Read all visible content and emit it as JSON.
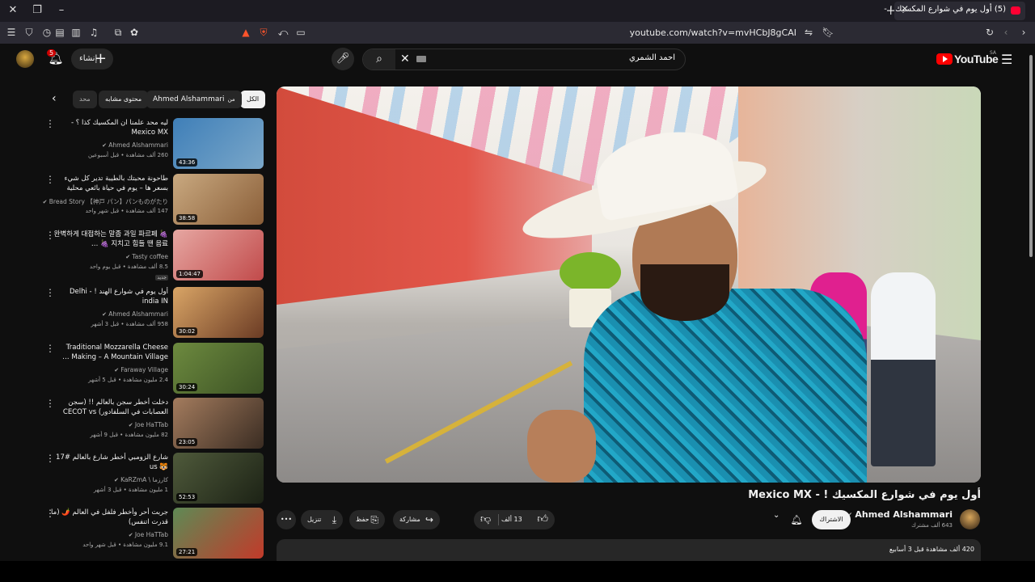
{
  "browser": {
    "tab_title": "(5) أول يوم في شوارع المكسيك ! -",
    "url": "youtube.com/watch?v=mvHCbJ8gCAI"
  },
  "masthead": {
    "logo": "YouTube",
    "region": "SA",
    "search_query": "احمد الشمري",
    "create_label": "إنشاء",
    "notif_count": "5"
  },
  "video": {
    "title": "أول يوم في شوارع المكسيك ! - Mexico MX",
    "channel": "Ahmed Alshammari",
    "subscribers": "643 ألف مشترك",
    "subscribe_label": "الاشتراك",
    "likes": "13 ألف",
    "share_label": "مشاركة",
    "save_label": "حفظ",
    "download_label": "تنزيل",
    "stats": "420 ألف مشاهدة قبل 3 أسابيع"
  },
  "chips": {
    "all": "الكل",
    "from": "من",
    "from_name": "Ahmed Alshammari",
    "related": "محتوى مشابه",
    "more": "محد"
  },
  "recs": [
    {
      "title": "ليه محد علمنا ان المكسيك كذا ؟ - Mexico MX",
      "channel": "Ahmed Alshammari",
      "meta": "260 ألف مشاهدة • قبل أسبوعين",
      "duration": "43:36",
      "colors": [
        "#3f7fb8",
        "#7aa7c9"
      ]
    },
    {
      "title": "طاحونة محبتك بالطيبة تدير كل شيء بسعر ها – يوم في حياة بائعي محلية",
      "channel": "Bread Story 【神戸 パン】パンものがたり",
      "meta": "147 ألف مشاهدة • قبل شهر واحد",
      "duration": "38:58",
      "colors": [
        "#c9a980",
        "#8a5e38"
      ]
    },
    {
      "title": "🍇 완벽하게 대접하는 말좀 과일 파르페 🍇 지치고 힘들 땐 음료 …",
      "channel": "Tasty coffee",
      "meta": "8.5 ألف مشاهدة • قبل يوم واحد",
      "duration": "1:04:47",
      "badge": "جديد",
      "colors": [
        "#e6a7a2",
        "#c14a4a"
      ]
    },
    {
      "title": "أول يوم في شوارع الهند ! - Delhi india IN",
      "channel": "Ahmed Alshammari",
      "meta": "958 ألف مشاهدة • قبل 3 أشهر",
      "duration": "30:02",
      "colors": [
        "#d9a566",
        "#6b3b24"
      ]
    },
    {
      "title": "Traditional Mozzarella Cheese Making – A Mountain Village …",
      "channel": "Faraway Village",
      "meta": "2.4 مليون مشاهدة • قبل 5 أشهر",
      "duration": "30:24",
      "colors": [
        "#6d8a3f",
        "#3c5224"
      ]
    },
    {
      "title": "دخلت أخطر سجن بالعالم !! (سجن العصابات في السلفادور) CECOT vs",
      "channel": "Joe HaTTab",
      "meta": "82 مليون مشاهدة • قبل 9 أشهر",
      "duration": "23:05",
      "colors": [
        "#a47c5e",
        "#3a2c22"
      ]
    },
    {
      "title": "شارع الزومبي أخطر شارع بالعالم #17 🐯 us",
      "channel": "KaRZmA \\ كارزما",
      "meta": "1 مليون مشاهدة • قبل 3 أشهر",
      "duration": "52:53",
      "colors": [
        "#4f5a3b",
        "#1c2215"
      ]
    },
    {
      "title": "جربت أحر وأخطر فلفل في العالم 🌶️ (ما قدرت اتنفس)",
      "channel": "Joe HaTTab",
      "meta": "9.1 مليون مشاهدة • قبل شهر واحد",
      "duration": "27:21",
      "colors": [
        "#5e8a55",
        "#c23a2a"
      ]
    }
  ]
}
